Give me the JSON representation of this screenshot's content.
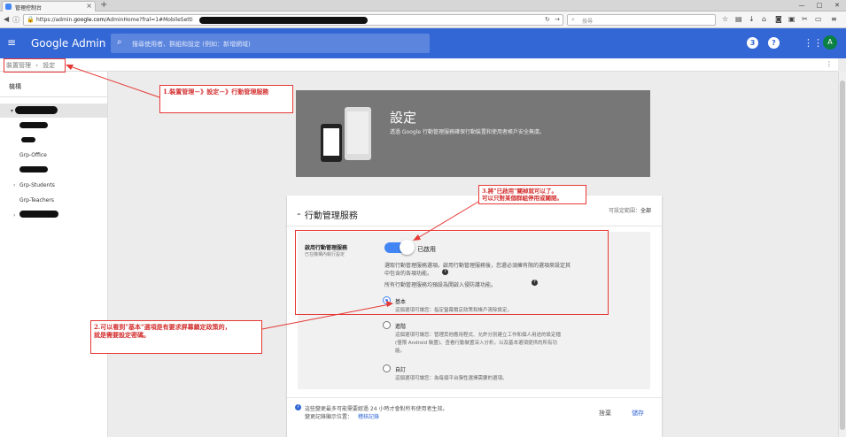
{
  "browser": {
    "tab_title": "管理控制台",
    "url_prefix": "https://admin.",
    "url_host": "google.com",
    "url_rest": "/AdminHome?fral=1#MobileSetti",
    "search_placeholder": "搜尋"
  },
  "header": {
    "brand": "Google Admin",
    "search_placeholder": "搜尋使用者、群組和設定 (例如：新增網域)",
    "avatar_initial": "A",
    "help_icon": "question-icon",
    "support_icon_label": "3"
  },
  "breadcrumb": {
    "items": [
      "裝置管理",
      "設定"
    ],
    "separator": "›"
  },
  "sidebar": {
    "title": "機構",
    "items": [
      "Grp-Office",
      "Grp-Students",
      "Grp-Teachers"
    ]
  },
  "hero": {
    "title": "設定",
    "description": "透過 Google 行動管理服務確保行動裝置和使用者帳戶安全無虞。"
  },
  "card": {
    "title": "行動管理服務",
    "scope_label": "可設定範圍：",
    "scope_value": "全部",
    "setting": {
      "name": "啟用行動管理服務",
      "sub": "已在機構內執行設定",
      "toggle_label": "已啟用",
      "toggle_on": true,
      "desc1": "選取行動管理服務選項。啟用行動管理服務後，您還必須擁有限的選項來設定其",
      "desc2": "中包含的各項功能。",
      "desc3": "所有行動管理服務均預設為開啟入侵防護功能。",
      "options": [
        {
          "label": "基本",
          "desc": "這個選項可讓您：指定螢幕鎖定政策和帳戶清除設定。",
          "selected": true
        },
        {
          "label": "進階",
          "desc1": "這個選項可讓您：管理其他應用程式、允許分別建立工作和個人用途的設定檔",
          "desc2": "(僅限 Android 裝置)、查看行動裝置深入分析，以及基本選項提供的所有功",
          "desc3": "能。",
          "selected": false
        },
        {
          "label": "自訂",
          "desc": "這個選項可讓您：為每個平台彈性選擇需要的選項。",
          "selected": false
        }
      ]
    },
    "footer_text1": "這些變更最多可能需要經過 24 小時才會對所有使用者生效。",
    "footer_text2": "變更記錄顯示位置：",
    "footer_link": "稽核記錄",
    "cancel": "捨棄",
    "save": "儲存"
  },
  "annotations": {
    "a1": "1.裝置管理－》設定－》行動管理服務",
    "a2_line1": "2.可以看到\"基本\"選項是有要求屏幕鎖定政策的，",
    "a2_line2": "就是需要設定密碼。",
    "a3_line1": "3.將\"已啟用\"關掉就可以了。",
    "a3_line2": "可以只對某個群組停用或關閉。",
    "color": "#d32f2f"
  }
}
